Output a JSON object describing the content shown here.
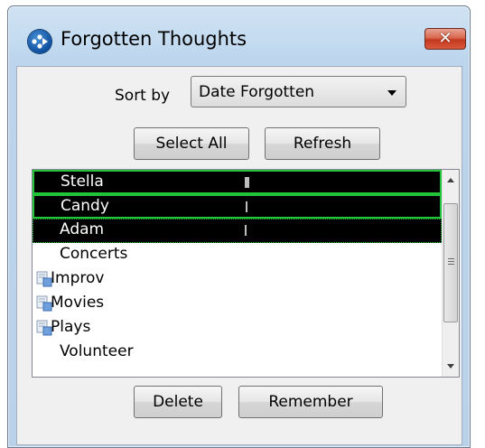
{
  "window": {
    "title": "Forgotten Thoughts",
    "close_label": "✕"
  },
  "sort": {
    "label": "Sort by",
    "selected": "Date Forgotten"
  },
  "toolbar": {
    "select_all_label": "Select All",
    "refresh_label": "Refresh"
  },
  "list": {
    "items": [
      {
        "label": "Stella",
        "selected": true,
        "icon": null
      },
      {
        "label": "Candy",
        "selected": true,
        "icon": null
      },
      {
        "label": "Adam",
        "selected": true,
        "icon": null
      },
      {
        "label": "Concerts",
        "selected": false,
        "icon": null
      },
      {
        "label": "Improv",
        "selected": false,
        "icon": "document-icon"
      },
      {
        "label": "Movies",
        "selected": false,
        "icon": "document-icon"
      },
      {
        "label": "Plays",
        "selected": false,
        "icon": "document-icon"
      },
      {
        "label": "Volunteer",
        "selected": false,
        "icon": null
      }
    ]
  },
  "actions": {
    "delete_label": "Delete",
    "remember_label": "Remember"
  }
}
